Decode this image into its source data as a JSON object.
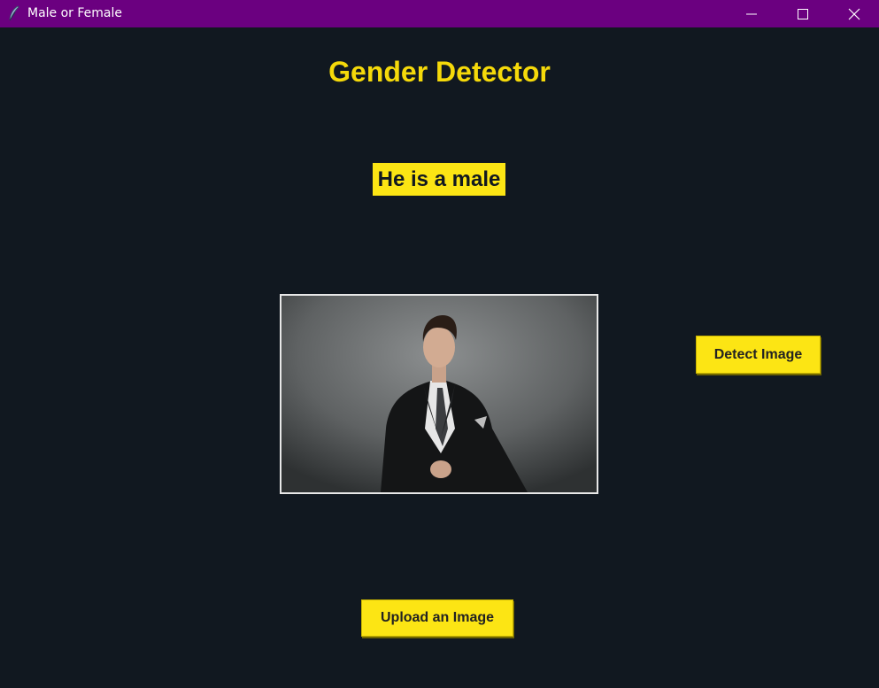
{
  "window": {
    "title": "Male or Female",
    "icon": "feather-icon",
    "controls": [
      "minimize-icon",
      "maximize-icon",
      "close-icon"
    ]
  },
  "main": {
    "heading": "Gender Detector",
    "result_label": "He is a male",
    "photo_alt": "man in black suit",
    "detect_button": "Detect Image",
    "upload_button": "Upload an Image"
  },
  "colors": {
    "titlebar": "#6b0080",
    "background": "#111820",
    "accent_yellow": "#fce514",
    "heading_yellow": "#f5d90a"
  }
}
